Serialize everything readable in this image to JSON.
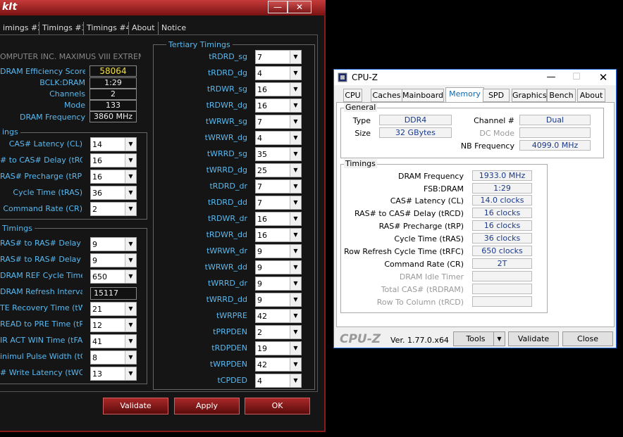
{
  "memtweakit": {
    "title": "kIt",
    "minimize": "—",
    "close": "✕",
    "tabs": [
      "imings #2",
      "Timings #3",
      "Timings #4",
      "About",
      "Notice"
    ],
    "board": "OMPUTER INC. MAXIMUS VIII EXTREME",
    "info": [
      {
        "label": "DRAM Efficiency Score",
        "value": "58064"
      },
      {
        "label": "BCLK:DRAM",
        "value": "1:29"
      },
      {
        "label": "Channels",
        "value": "2"
      },
      {
        "label": "Mode",
        "value": "133"
      },
      {
        "label": "DRAM Frequency",
        "value": "3860 MHz"
      }
    ],
    "primary_title": "ings",
    "primary": [
      {
        "label": "CAS# Latency (CL)",
        "value": "14"
      },
      {
        "label": "# to CAS# Delay (tRCD)",
        "value": "16"
      },
      {
        "label": "RAS# Precharge (tRP)",
        "value": "16"
      },
      {
        "label": "Cycle Time (tRAS)",
        "value": "36"
      },
      {
        "label": "Command Rate (CR)",
        "value": "2"
      }
    ],
    "secondary_title": "Timings",
    "secondary": [
      {
        "label": "RAS# to RAS# Delay L",
        "value": "9",
        "type": "select"
      },
      {
        "label": "RAS# to RAS# Delay S",
        "value": "9",
        "type": "select"
      },
      {
        "label": "DRAM REF Cycle Time",
        "value": "650",
        "type": "select"
      },
      {
        "label": "DRAM Refresh Interval",
        "value": "15117",
        "type": "field"
      },
      {
        "label": "TE Recovery Time (tWR)",
        "value": "21",
        "type": "select"
      },
      {
        "label": "READ to PRE Time (tRTP)",
        "value": "12",
        "type": "select"
      },
      {
        "label": "IR ACT WIN Time (tFAW)",
        "value": "41",
        "type": "select"
      },
      {
        "label": "inimul Pulse Width (tCKE)",
        "value": "8",
        "type": "select"
      },
      {
        "label": "# Write Latency (tWCL)",
        "value": "13",
        "type": "select"
      }
    ],
    "tertiary_title": "Tertiary Timings",
    "tertiary": [
      {
        "label": "tRDRD_sg",
        "value": "7"
      },
      {
        "label": "tRDRD_dg",
        "value": "4"
      },
      {
        "label": "tRDWR_sg",
        "value": "16"
      },
      {
        "label": "tRDWR_dg",
        "value": "16"
      },
      {
        "label": "tWRWR_sg",
        "value": "7"
      },
      {
        "label": "tWRWR_dg",
        "value": "4"
      },
      {
        "label": "tWRRD_sg",
        "value": "35"
      },
      {
        "label": "tWRRD_dg",
        "value": "25"
      },
      {
        "label": "tRDRD_dr",
        "value": "7"
      },
      {
        "label": "tRDRD_dd",
        "value": "7"
      },
      {
        "label": "tRDWR_dr",
        "value": "16"
      },
      {
        "label": "tRDWR_dd",
        "value": "16"
      },
      {
        "label": "tWRWR_dr",
        "value": "9"
      },
      {
        "label": "tWRWR_dd",
        "value": "9"
      },
      {
        "label": "tWRRD_dr",
        "value": "9"
      },
      {
        "label": "tWRRD_dd",
        "value": "9"
      },
      {
        "label": "tWRPRE",
        "value": "42"
      },
      {
        "label": "tPRPDEN",
        "value": "2"
      },
      {
        "label": "tRDPDEN",
        "value": "19"
      },
      {
        "label": "tWRPDEN",
        "value": "42"
      },
      {
        "label": "tCPDED",
        "value": "4"
      }
    ],
    "buttons": {
      "validate": "Validate",
      "apply": "Apply",
      "ok": "OK"
    }
  },
  "cpuz": {
    "title": "CPU-Z",
    "tabs": [
      "CPU",
      "Caches",
      "Mainboard",
      "Memory",
      "SPD",
      "Graphics",
      "Bench",
      "About"
    ],
    "active_tab": "Memory",
    "general_title": "General",
    "general": {
      "type_label": "Type",
      "type": "DDR4",
      "size_label": "Size",
      "size": "32 GBytes",
      "channel_label": "Channel #",
      "channel": "Dual",
      "dcmode_label": "DC Mode",
      "dcmode": "",
      "nb_label": "NB Frequency",
      "nb": "4099.0 MHz"
    },
    "timings_title": "Timings",
    "timings": [
      {
        "label": "DRAM Frequency",
        "value": "1933.0 MHz",
        "dim": false
      },
      {
        "label": "FSB:DRAM",
        "value": "1:29",
        "dim": false
      },
      {
        "label": "CAS# Latency (CL)",
        "value": "14.0 clocks",
        "dim": false
      },
      {
        "label": "RAS# to CAS# Delay (tRCD)",
        "value": "16 clocks",
        "dim": false
      },
      {
        "label": "RAS# Precharge (tRP)",
        "value": "16 clocks",
        "dim": false
      },
      {
        "label": "Cycle Time (tRAS)",
        "value": "36 clocks",
        "dim": false
      },
      {
        "label": "Row Refresh Cycle Time (tRFC)",
        "value": "650 clocks",
        "dim": false
      },
      {
        "label": "Command Rate (CR)",
        "value": "2T",
        "dim": false
      },
      {
        "label": "DRAM Idle Timer",
        "value": "",
        "dim": true
      },
      {
        "label": "Total CAS# (tRDRAM)",
        "value": "",
        "dim": true
      },
      {
        "label": "Row To Column (tRCD)",
        "value": "",
        "dim": true
      }
    ],
    "logo": "CPU-Z",
    "version": "Ver. 1.77.0.x64",
    "tools": "Tools",
    "validate": "Validate",
    "close": "Close"
  },
  "colors": {
    "accent_red": "#8a1a1a",
    "label_blue": "#5ab9f0",
    "score_yellow": "#f0e040",
    "cpuz_value": "#1a3a8a"
  }
}
